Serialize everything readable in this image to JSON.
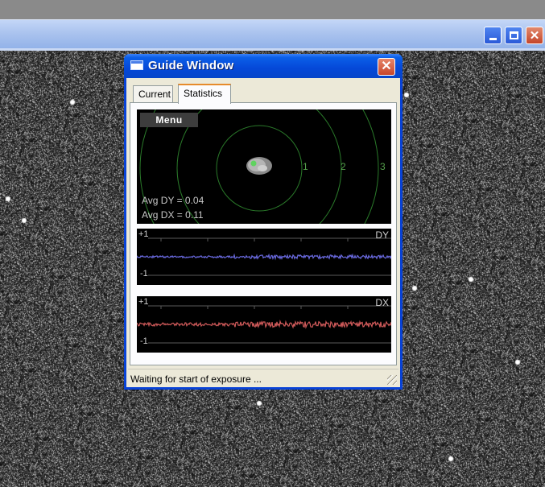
{
  "guide_window": {
    "title": "Guide Window",
    "tabs": [
      {
        "label": "Current",
        "selected": false
      },
      {
        "label": "Statistics",
        "selected": true
      }
    ],
    "menu_label": "Menu",
    "ring_labels": [
      "1",
      "2",
      "3"
    ],
    "avg_dy": "Avg DY = 0.04",
    "avg_dx": "Avg DX = 0.11",
    "dy_graph": {
      "plus_label": "+1",
      "minus_label": "-1",
      "axis_label": "DY"
    },
    "dx_graph": {
      "plus_label": "+1",
      "minus_label": "-1",
      "axis_label": "DX"
    },
    "status": "Waiting for start of exposure ..."
  },
  "icons": {
    "app": "window-icon",
    "close": "close-icon",
    "minimize": "minimize-icon",
    "maximize": "maximize-icon",
    "resize": "resize-grip-icon"
  },
  "colors": {
    "titlebar": "#0548d8",
    "ring": "#2a7a2a",
    "dy_trace": "#6a6ae0",
    "dx_trace": "#d05a5a"
  }
}
